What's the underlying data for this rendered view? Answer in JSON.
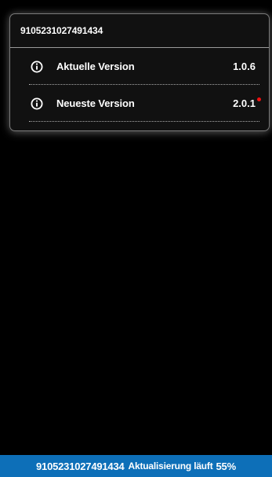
{
  "card": {
    "title": "9105231027491434",
    "rows": [
      {
        "icon": "info-icon",
        "label": "Aktuelle Version",
        "value": "1.0.6",
        "has_update_dot": false
      },
      {
        "icon": "info-icon",
        "label": "Neueste Version",
        "value": "2.0.1",
        "has_update_dot": true
      }
    ]
  },
  "status": {
    "device_id": "9105231027491434",
    "text": "Aktualisierung läuft",
    "percent": "55%",
    "progress": 0.55
  },
  "colors": {
    "background": "#000000",
    "card_border": "#7a7a7a",
    "status_bar": "#0d6fb8",
    "update_dot": "#ee1111"
  }
}
